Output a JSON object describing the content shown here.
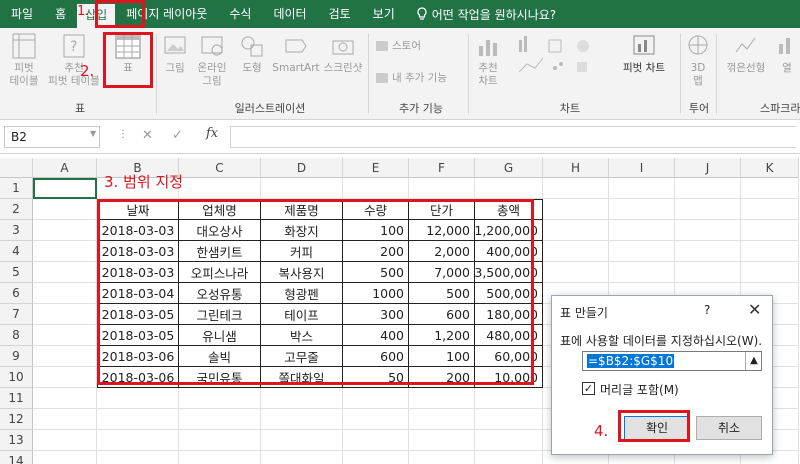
{
  "menu": {
    "tabs": [
      "파일",
      "홈",
      "삽입",
      "페이지 레이아웃",
      "수식",
      "데이터",
      "검토",
      "보기"
    ],
    "tell_me": "어떤 작업을 원하시나요?"
  },
  "ribbon": {
    "pivot_table": "피벗\n테이블",
    "recommended_pivot": "추천\n피벗 테이블",
    "table": "표",
    "pictures": "그림",
    "online_pictures": "온라인\n그림",
    "shapes": "도형",
    "smartart": "SmartArt",
    "screenshot": "스크린샷",
    "store": "스토어",
    "my_addins": "내 추가 기능",
    "recommended_charts": "추천\n차트",
    "pivot_chart": "피벗 차트",
    "map_3d": "3D\n맵",
    "line_sparkline": "꺾은선형",
    "column_sparkline": "열",
    "groups": {
      "tables": "표",
      "illustrations": "일러스트레이션",
      "addins": "추가 기능",
      "charts": "차트",
      "tours": "투어",
      "sparklines": "스파크라"
    }
  },
  "formula_bar": {
    "name_box": "B2",
    "cancel": "✕",
    "enter": "✓",
    "fx": "fx"
  },
  "sheet": {
    "columns": [
      "A",
      "B",
      "C",
      "D",
      "E",
      "F",
      "G",
      "H",
      "I",
      "J",
      "K"
    ],
    "rows": [
      "1",
      "2",
      "3",
      "4",
      "5",
      "6",
      "7",
      "8",
      "9",
      "10",
      "11",
      "12",
      "13",
      "14"
    ],
    "headers": [
      "날짜",
      "업체명",
      "제품명",
      "수량",
      "단가",
      "총액"
    ],
    "data": [
      [
        "2018-03-03",
        "대오상사",
        "화장지",
        "100",
        "12,000",
        "1,200,000"
      ],
      [
        "2018-03-03",
        "한샘키트",
        "커피",
        "200",
        "2,000",
        "400,000"
      ],
      [
        "2018-03-03",
        "오피스나라",
        "복사용지",
        "500",
        "7,000",
        "3,500,000"
      ],
      [
        "2018-03-04",
        "오성유통",
        "형광펜",
        "1000",
        "500",
        "500,000"
      ],
      [
        "2018-03-05",
        "그린테크",
        "테이프",
        "300",
        "600",
        "180,000"
      ],
      [
        "2018-03-05",
        "유니샘",
        "박스",
        "400",
        "1,200",
        "480,000"
      ],
      [
        "2018-03-06",
        "솔빅",
        "고무줄",
        "600",
        "100",
        "60,000"
      ],
      [
        "2018-03-06",
        "국민유통",
        "쫄대화일",
        "50",
        "200",
        "10,000"
      ]
    ]
  },
  "dialog": {
    "title": "표 만들기",
    "help": "?",
    "close": "✕",
    "prompt": "표에 사용할 데이터를 지정하십시오(W).",
    "range": "=$B$2:$G$10",
    "has_headers_label": "머리글 포함(M)",
    "has_headers_checked": true,
    "ok": "확인",
    "cancel": "취소"
  },
  "annotations": {
    "step1": "1.",
    "step2": "2.",
    "step3": "3. 범위 지정",
    "step4": "4."
  },
  "colors": {
    "excel_green": "#217346",
    "highlight_red": "#e0141e"
  }
}
